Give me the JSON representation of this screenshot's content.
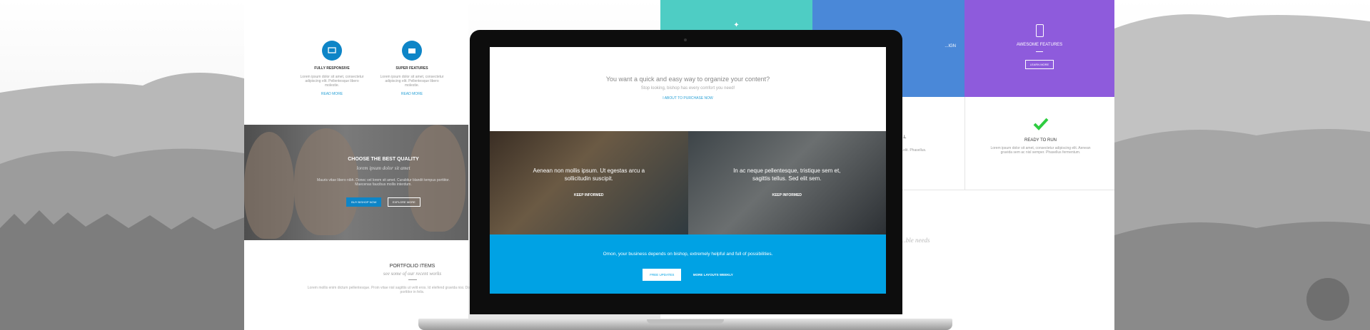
{
  "left_page": {
    "features": [
      {
        "title": "FULLY RESPONSIVE",
        "text": "Lorem ipsum dolor sit amet, consectetur adipiscing elit. Pellentesque libero molestie.",
        "link": "READ MORE"
      },
      {
        "title": "SUPER FEATURES",
        "text": "Lorem ipsum dolor sit amet, consectetur adipiscing elit. Pellentesque libero molestie.",
        "link": "READ MORE"
      }
    ],
    "quality": {
      "title": "CHOOSE THE BEST QUALITY",
      "subtitle": "lorem ipsum dolor sit amet",
      "text": "Mauris vitae libero nibh. Donec vel lorem sit amet. Curabitur blandit tempus porttitor. Maecenas faucibus mollis interdum.",
      "btn_buy": "BUY BISHOP NOW",
      "btn_explore": "EXPLORE MORE"
    },
    "portfolio": {
      "title": "PORTFOLIO ITEMS",
      "subtitle": "see some of our recent works",
      "text": "Lorem mollis enim dictum pellentesque. Proin vitae nisl sagittis ut velit eros. Id eleifend gravida nisi. Donec quis risus id ipsum. Etiam porttitor in felis."
    }
  },
  "right_page": {
    "cards": [
      {
        "title": "",
        "color": "#4ecdc4"
      },
      {
        "title": "...IGN",
        "color": "#4a88d8"
      },
      {
        "title": "AWESOME FEATURES",
        "color": "#8e5bdc",
        "button": "LEARN MORE"
      }
    ],
    "ready": {
      "title": "READY TO RUN",
      "text": "Lorem ipsum dolor sit amet, consectetur adipiscing elit. Aenean gravida sem ac nisl semper. Phasellus fermentum."
    },
    "partial_left": "...L",
    "partial_text": "...elit. Phasellus.",
    "script_text": "...ble needs"
  },
  "laptop": {
    "hero": {
      "title": "You want a quick and easy way to organize your content?",
      "subtitle": "Stop looking, bishop has every comfort you need!",
      "link": "I ABOUT TO PURCHASE NOW"
    },
    "panels": [
      {
        "text": "Aenean non mollis ipsum. Ut egestas arcu a sollicitudin suscipit.",
        "link": "KEEP INFORMED"
      },
      {
        "text": "In ac neque pellentesque, tristique sem et, sagittis tellus. Sed elit sem.",
        "link": "KEEP INFORMED"
      }
    ],
    "cta": {
      "text": "Omon, your business depends on bishop, extremely helpful and full of possibilities.",
      "btn_primary": "FREE UPDATES",
      "btn_secondary": "MORE LAYOUTS WEEKLY",
      "color": "#00a2e4"
    }
  }
}
